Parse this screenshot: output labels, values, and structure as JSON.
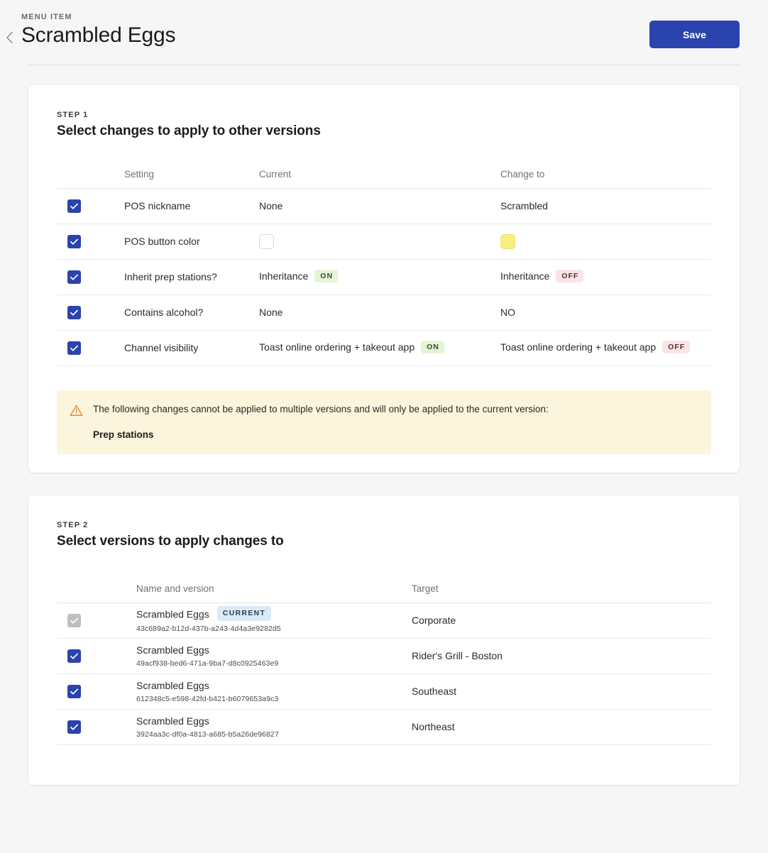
{
  "header": {
    "eyebrow": "MENU ITEM",
    "title": "Scrambled Eggs",
    "back_icon": "chevron-left-icon",
    "save_label": "Save",
    "save_color": "#2b43ae"
  },
  "step1": {
    "eyebrow": "STEP 1",
    "title": "Select changes to apply to other versions",
    "columns": {
      "check": "",
      "setting": "Setting",
      "current": "Current",
      "change_to": "Change to"
    },
    "rows": [
      {
        "checked": true,
        "setting": "POS nickname",
        "current_text": "None",
        "current_badge": null,
        "current_swatch": null,
        "change_text": "Scrambled",
        "change_badge": null,
        "change_swatch": null
      },
      {
        "checked": true,
        "setting": "POS button color",
        "current_text": "",
        "current_badge": null,
        "current_swatch": "#ffffff",
        "change_text": "",
        "change_badge": null,
        "change_swatch": "#f7f07e"
      },
      {
        "checked": true,
        "setting": "Inherit prep stations?",
        "current_text": "Inheritance",
        "current_badge": "ON",
        "current_swatch": null,
        "change_text": "Inheritance",
        "change_badge": "OFF",
        "change_swatch": null
      },
      {
        "checked": true,
        "setting": "Contains alcohol?",
        "current_text": "None",
        "current_badge": null,
        "current_swatch": null,
        "change_text": "NO",
        "change_badge": null,
        "change_swatch": null
      },
      {
        "checked": true,
        "setting": "Channel visibility",
        "current_text": "Toast online ordering + takeout app",
        "current_badge": "ON",
        "current_swatch": null,
        "change_text": "Toast online ordering + takeout app",
        "change_badge": "OFF",
        "change_swatch": null
      }
    ],
    "warning": {
      "icon": "warning-triangle-icon",
      "icon_color": "#e8821e",
      "background": "#fcf5dd",
      "message": "The following changes cannot be applied to multiple versions and will only be applied to the current version:",
      "items": [
        "Prep stations"
      ]
    }
  },
  "step2": {
    "eyebrow": "STEP 2",
    "title": "Select versions to apply changes to",
    "columns": {
      "check": "",
      "name": "Name and version",
      "target": "Target"
    },
    "rows": [
      {
        "checked": true,
        "disabled": true,
        "name": "Scrambled Eggs",
        "badge": "CURRENT",
        "uuid": "43c689a2-b12d-437b-a243-4d4a3e9282d5",
        "target": "Corporate"
      },
      {
        "checked": true,
        "disabled": false,
        "name": "Scrambled Eggs",
        "badge": null,
        "uuid": "49acf938-bed6-471a-9ba7-d8c0925463e9",
        "target": "Rider's Grill - Boston"
      },
      {
        "checked": true,
        "disabled": false,
        "name": "Scrambled Eggs",
        "badge": null,
        "uuid": "612348c5-e598-42fd-b421-b6079653a9c3",
        "target": "Southeast"
      },
      {
        "checked": true,
        "disabled": false,
        "name": "Scrambled Eggs",
        "badge": null,
        "uuid": "3924aa3c-df0a-4813-a685-b5a26de96827",
        "target": "Northeast"
      }
    ]
  }
}
